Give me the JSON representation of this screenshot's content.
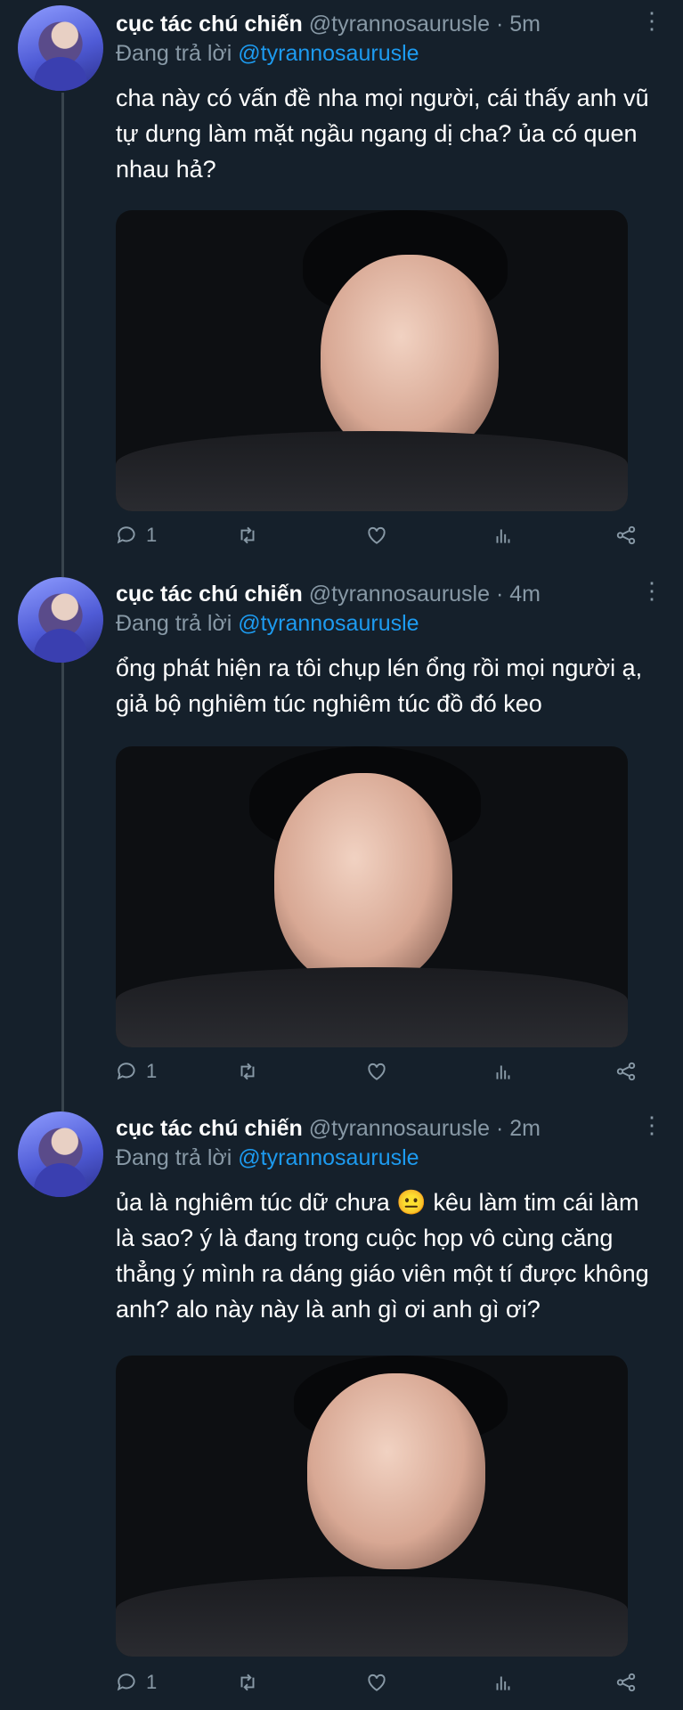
{
  "tweets": [
    {
      "display_name": "cục tác chú chiến",
      "handle": "@tyrannosaurusle",
      "separator": "·",
      "time": "5m",
      "reply_prefix": "Đang trả lời",
      "reply_handle": "@tyrannosaurusle",
      "text": "cha này có vấn đề nha mọi người, cái thấy anh vũ tự dưng làm mặt ngầu ngang dị cha? ủa có quen nhau hả?",
      "reply_count": "1"
    },
    {
      "display_name": "cục tác chú chiến",
      "handle": "@tyrannosaurusle",
      "separator": "·",
      "time": "4m",
      "reply_prefix": "Đang trả lời",
      "reply_handle": "@tyrannosaurusle",
      "text": "ổng phát hiện ra tôi chụp lén ổng rồi mọi người ạ, giả bộ nghiêm túc nghiêm túc đồ đó keo",
      "reply_count": "1"
    },
    {
      "display_name": "cục tác chú chiến",
      "handle": "@tyrannosaurusle",
      "separator": "·",
      "time": "2m",
      "reply_prefix": "Đang trả lời",
      "reply_handle": "@tyrannosaurusle",
      "text": "ủa là nghiêm túc dữ chưa 😐 kêu làm tim cái làm là sao? ý là đang trong cuộc họp vô cùng căng thẳng ý mình ra dáng giáo viên một tí được không anh? alo này này là anh gì ơi anh gì ơi?",
      "reply_count": "1"
    }
  ],
  "icons": {
    "reply": "reply-icon",
    "retweet": "retweet-icon",
    "like": "heart-icon",
    "analytics": "analytics-icon",
    "share": "share-icon",
    "more": "more-icon"
  },
  "colors": {
    "background": "#15202b",
    "muted": "#8899a6",
    "link": "#1d9bf0"
  }
}
